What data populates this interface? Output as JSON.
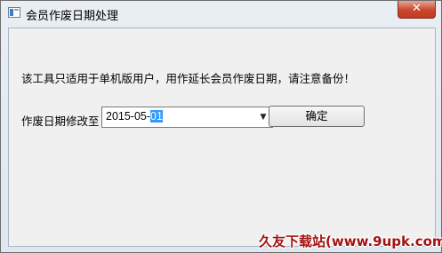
{
  "window": {
    "title": "会员作废日期处理",
    "close_glyph": "✕"
  },
  "main": {
    "notice": "该工具只适用于单机版用户，用作延长会员作废日期，请注意备份！",
    "date_label": "作废日期修改至",
    "date_value_prefix": "2015-05-",
    "date_value_selected": "01",
    "dropdown_glyph": "▼",
    "ok_label": "确定"
  },
  "watermark": {
    "text": "久友下载站(www.9upk.com)"
  },
  "colors": {
    "selection": "#3399ff",
    "close_button": "#c8472d",
    "watermark": "#a31212"
  }
}
